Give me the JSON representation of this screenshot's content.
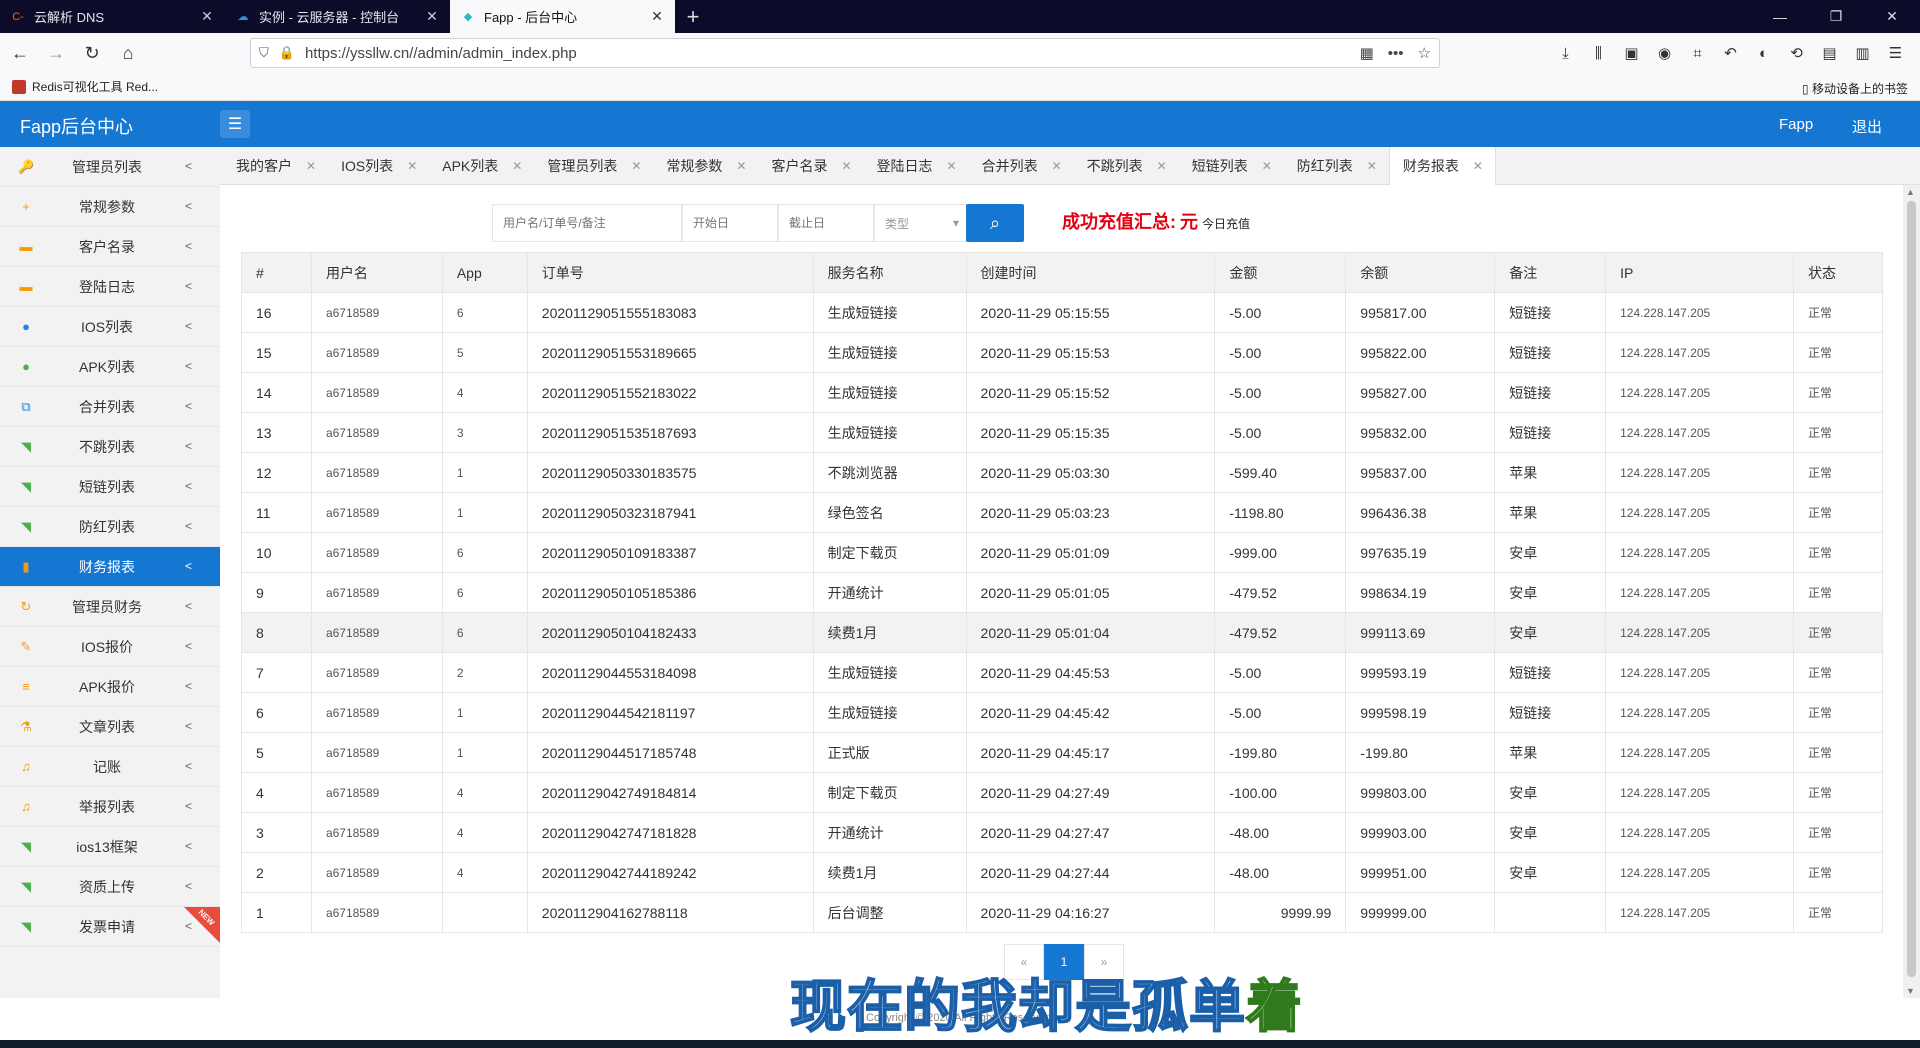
{
  "browser": {
    "tabs": [
      {
        "label": "云解析 DNS",
        "active": false,
        "fav": "C-",
        "favcolor": "#ff6a00"
      },
      {
        "label": "实例 - 云服务器 - 控制台",
        "active": false,
        "fav": "☁",
        "favcolor": "#3a8ddc"
      },
      {
        "label": "Fapp - 后台中心",
        "active": true,
        "fav": "◆",
        "favcolor": "#2bb7c9"
      }
    ],
    "url": "https://yssllw.cn//admin/admin_index.php",
    "bookmark": "Redis可视化工具 Red...",
    "mobile_bookmarks": "移动设备上的书签"
  },
  "header": {
    "brand": "Fapp后台中心",
    "user": "Fapp",
    "logout": "退出"
  },
  "sidebar": {
    "items": [
      {
        "label": "管理员列表",
        "icon": "🔑",
        "color": "#f39c12"
      },
      {
        "label": "常规参数",
        "icon": "+",
        "color": "#f39c12"
      },
      {
        "label": "客户名录",
        "icon": "▬",
        "color": "#f39c12"
      },
      {
        "label": "登陆日志",
        "icon": "▬",
        "color": "#f39c12"
      },
      {
        "label": "IOS列表",
        "icon": "●",
        "color": "#1e88e5"
      },
      {
        "label": "APK列表",
        "icon": "●",
        "color": "#4caf50"
      },
      {
        "label": "合并列表",
        "icon": "⧉",
        "color": "#1e88e5"
      },
      {
        "label": "不跳列表",
        "icon": "◥",
        "color": "#4caf50"
      },
      {
        "label": "短链列表",
        "icon": "◥",
        "color": "#4caf50"
      },
      {
        "label": "防红列表",
        "icon": "◥",
        "color": "#4caf50"
      },
      {
        "label": "财务报表",
        "icon": "▮",
        "color": "#f39c12",
        "active": true
      },
      {
        "label": "管理员财务",
        "icon": "↻",
        "color": "#f39c12"
      },
      {
        "label": "IOS报价",
        "icon": "✎",
        "color": "#f39c12"
      },
      {
        "label": "APK报价",
        "icon": "≡",
        "color": "#f39c12"
      },
      {
        "label": "文章列表",
        "icon": "⚗",
        "color": "#f39c12"
      },
      {
        "label": "记账",
        "icon": "♫",
        "color": "#f39c12"
      },
      {
        "label": "举报列表",
        "icon": "♫",
        "color": "#f39c12"
      },
      {
        "label": "ios13框架",
        "icon": "◥",
        "color": "#4caf50"
      },
      {
        "label": "资质上传",
        "icon": "◥",
        "color": "#4caf50"
      },
      {
        "label": "发票申请",
        "icon": "◥",
        "color": "#4caf50",
        "badge": "NEW"
      }
    ]
  },
  "content_tabs": [
    "我的客户",
    "IOS列表",
    "APK列表",
    "管理员列表",
    "常规参数",
    "客户名录",
    "登陆日志",
    "合并列表",
    "不跳列表",
    "短链列表",
    "防红列表",
    "财务报表"
  ],
  "filter": {
    "keyword_placeholder": "用户名/订单号/备注",
    "start_placeholder": "开始日",
    "end_placeholder": "截止日",
    "type_placeholder": "类型"
  },
  "summary": {
    "label": "成功充值汇总:",
    "unit": "元",
    "today": "今日充值"
  },
  "table": {
    "headers": [
      "#",
      "用户名",
      "App",
      "订单号",
      "服务名称",
      "创建时间",
      "金额",
      "余额",
      "备注",
      "IP",
      "状态"
    ],
    "rows": [
      [
        "16",
        "a6718589",
        "6",
        "20201129051555183083",
        "生成短链接",
        "2020-11-29 05:15:55",
        "-5.00",
        "995817.00",
        "短链接",
        "124.228.147.205",
        "正常"
      ],
      [
        "15",
        "a6718589",
        "5",
        "20201129051553189665",
        "生成短链接",
        "2020-11-29 05:15:53",
        "-5.00",
        "995822.00",
        "短链接",
        "124.228.147.205",
        "正常"
      ],
      [
        "14",
        "a6718589",
        "4",
        "20201129051552183022",
        "生成短链接",
        "2020-11-29 05:15:52",
        "-5.00",
        "995827.00",
        "短链接",
        "124.228.147.205",
        "正常"
      ],
      [
        "13",
        "a6718589",
        "3",
        "20201129051535187693",
        "生成短链接",
        "2020-11-29 05:15:35",
        "-5.00",
        "995832.00",
        "短链接",
        "124.228.147.205",
        "正常"
      ],
      [
        "12",
        "a6718589",
        "1",
        "20201129050330183575",
        "不跳浏览器",
        "2020-11-29 05:03:30",
        "-599.40",
        "995837.00",
        "苹果",
        "124.228.147.205",
        "正常"
      ],
      [
        "11",
        "a6718589",
        "1",
        "20201129050323187941",
        "绿色签名",
        "2020-11-29 05:03:23",
        "-1198.80",
        "996436.38",
        "苹果",
        "124.228.147.205",
        "正常"
      ],
      [
        "10",
        "a6718589",
        "6",
        "20201129050109183387",
        "制定下载页",
        "2020-11-29 05:01:09",
        "-999.00",
        "997635.19",
        "安卓",
        "124.228.147.205",
        "正常"
      ],
      [
        "9",
        "a6718589",
        "6",
        "20201129050105185386",
        "开通统计",
        "2020-11-29 05:01:05",
        "-479.52",
        "998634.19",
        "安卓",
        "124.228.147.205",
        "正常"
      ],
      [
        "8",
        "a6718589",
        "6",
        "20201129050104182433",
        "续费1月",
        "2020-11-29 05:01:04",
        "-479.52",
        "999113.69",
        "安卓",
        "124.228.147.205",
        "正常"
      ],
      [
        "7",
        "a6718589",
        "2",
        "20201129044553184098",
        "生成短链接",
        "2020-11-29 04:45:53",
        "-5.00",
        "999593.19",
        "短链接",
        "124.228.147.205",
        "正常"
      ],
      [
        "6",
        "a6718589",
        "1",
        "20201129044542181197",
        "生成短链接",
        "2020-11-29 04:45:42",
        "-5.00",
        "999598.19",
        "短链接",
        "124.228.147.205",
        "正常"
      ],
      [
        "5",
        "a6718589",
        "1",
        "20201129044517185748",
        "正式版",
        "2020-11-29 04:45:17",
        "-199.80",
        "-199.80",
        "苹果",
        "124.228.147.205",
        "正常"
      ],
      [
        "4",
        "a6718589",
        "4",
        "20201129042749184814",
        "制定下载页",
        "2020-11-29 04:27:49",
        "-100.00",
        "999803.00",
        "安卓",
        "124.228.147.205",
        "正常"
      ],
      [
        "3",
        "a6718589",
        "4",
        "20201129042747181828",
        "开通统计",
        "2020-11-29 04:27:47",
        "-48.00",
        "999903.00",
        "安卓",
        "124.228.147.205",
        "正常"
      ],
      [
        "2",
        "a6718589",
        "4",
        "20201129042744189242",
        "续费1月",
        "2020-11-29 04:27:44",
        "-48.00",
        "999951.00",
        "安卓",
        "124.228.147.205",
        "正常"
      ],
      [
        "1",
        "a6718589",
        "",
        "2020112904162788118",
        "后台调整",
        "2020-11-29 04:16:27",
        "9999.99",
        "999999.00",
        "",
        "124.228.147.205",
        "正常"
      ]
    ]
  },
  "pager": {
    "prev": "«",
    "current": "1",
    "next": "»"
  },
  "footer": "Copyright © 2020 All Rights Reserved",
  "subtitle": {
    "main": "现在的我却是孤单",
    "end": "着"
  }
}
